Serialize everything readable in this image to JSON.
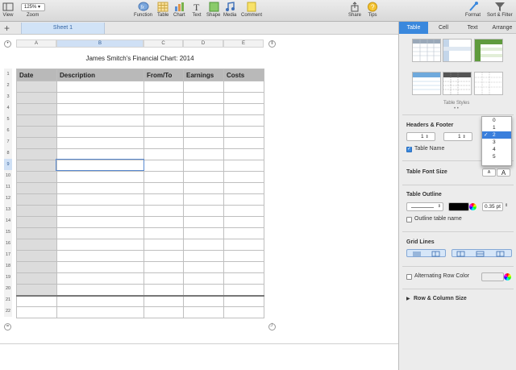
{
  "toolbar": {
    "view_label": "View",
    "zoom_value": "125%",
    "zoom_label": "Zoom",
    "function_label": "Function",
    "table_label": "Table",
    "chart_label": "Chart",
    "text_label": "Text",
    "shape_label": "Shape",
    "media_label": "Media",
    "comment_label": "Comment",
    "share_label": "Share",
    "tips_label": "Tips",
    "format_label": "Format",
    "sort_filter_label": "Sort & Filter"
  },
  "sheet_tab": "Sheet 1",
  "columns": [
    "A",
    "B",
    "C",
    "D",
    "E"
  ],
  "rows": [
    "1",
    "2",
    "3",
    "4",
    "5",
    "6",
    "7",
    "8",
    "9",
    "10",
    "11",
    "12",
    "13",
    "14",
    "15",
    "16",
    "17",
    "18",
    "19",
    "20",
    "21",
    "22"
  ],
  "table": {
    "title": "James Smitch's Financial Chart: 2014",
    "headers": [
      "Date",
      "Description",
      "From/To",
      "Earnings",
      "Costs"
    ]
  },
  "panel": {
    "tabs": [
      "Table",
      "Cell",
      "Text",
      "Arrange"
    ],
    "table_styles_label": "Table Styles",
    "headers_footer_label": "Headers & Footer",
    "header_rows_value": "1",
    "header_cols_value": "1",
    "table_name_label": "Table Name",
    "font_size_label": "Table Font Size",
    "font_small": "A",
    "font_large": "A",
    "outline_label": "Table Outline",
    "outline_width": "0.35 pt",
    "outline_name_label": "Outline table name",
    "grid_lines_label": "Grid Lines",
    "alt_row_label": "Alternating Row Color",
    "row_col_size_label": "Row & Column Size",
    "footer_options": [
      "0",
      "1",
      "2",
      "3",
      "4",
      "5"
    ],
    "footer_selected": "2"
  },
  "colors": {
    "accent": "#3a88dd",
    "header_fill": "#b9b9b9",
    "header_col_fill": "#dcdcdc",
    "selection": "#5a8ad0"
  }
}
